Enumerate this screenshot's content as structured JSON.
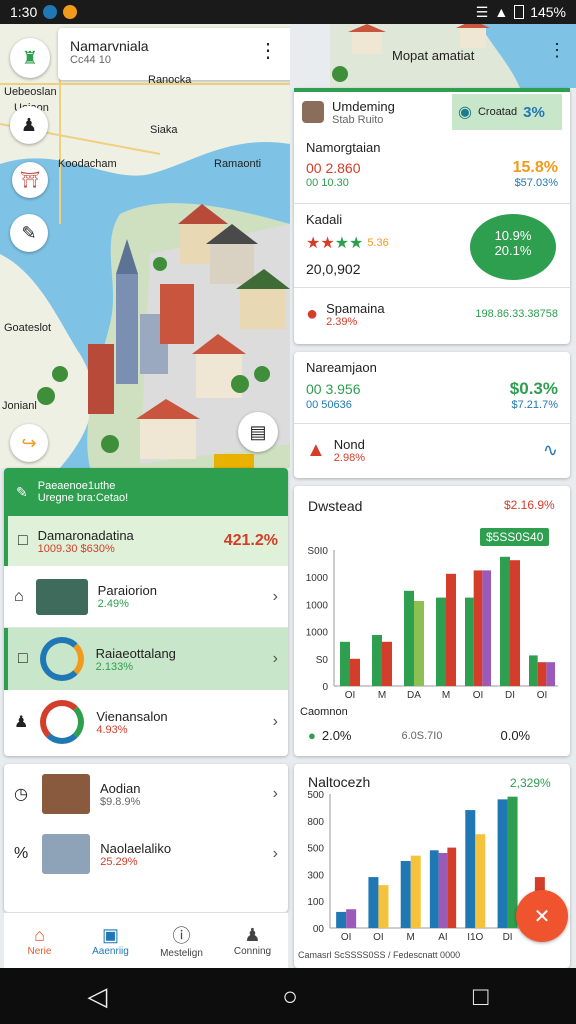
{
  "status": {
    "time": "1:30",
    "battery": "145%"
  },
  "map_header": {
    "title": "Namarvniala",
    "subtitle": "Cc44 10",
    "map_label": "Ranocka"
  },
  "map_labels": [
    "Uebeoslan",
    "Uoiaon",
    "Koodacham",
    "Ramaonti",
    "Siaka",
    "Goateslot",
    "Jonianl"
  ],
  "map2_label": "Mopat amatiat",
  "panel_header": {
    "title": "Umdeming",
    "subtitle": "Stab Ruito",
    "badge_label": "Croatad",
    "badge_value": "3%"
  },
  "stat1": {
    "title": "Namorgtaian",
    "row1_label": "00 2.860",
    "row1_value": "15.8%",
    "row2_label": "00 10.30",
    "row2_value": "$57.03%"
  },
  "stat2": {
    "title": "Kadali",
    "icons_value": "5.36",
    "big_value": "20,0,902",
    "circle_top": "10.9%",
    "circle_bottom": "20.1%"
  },
  "stat3": {
    "title": "Spamaina",
    "subtitle": "2.39%",
    "value": "198.86.33.38758"
  },
  "stat4": {
    "title": "Nareamjaon",
    "row1_label": "00 3.956",
    "row1_value": "$0.3%",
    "row2_label": "00 50636",
    "row2_value": "$7.21.7%"
  },
  "stat5": {
    "title": "Nond",
    "subtitle": "2.98%"
  },
  "chart1_card": {
    "title": "Dwstead",
    "value": "$2.16.9%",
    "badge": "$5SS0S40",
    "footer_label": "Caomnon",
    "footer_pct": "2.0%",
    "footer_mid": "6.0S.7I0",
    "footer_right": "0.0%"
  },
  "chart2_card": {
    "title": "Naltocezh",
    "value": "2,329%",
    "footer": "Camasrl  ScSSSS0SS / Fedescnatt 0000"
  },
  "list_header": {
    "title": "Paeaenoe1uthe",
    "subtitle": "Uregne bra:Cetao!"
  },
  "list_items": [
    {
      "title": "Damaronadatina",
      "sub": "1009.30  $630%",
      "value": "421.2%"
    },
    {
      "title": "Paraiorion",
      "sub": "2.49%"
    },
    {
      "title": "Raiaeottalang",
      "sub": "2.133%"
    },
    {
      "title": "Vienansalon",
      "sub": "4.93%"
    }
  ],
  "list2_items": [
    {
      "title": "Aodian",
      "sub": "$9.8.9%"
    },
    {
      "title": "Naolaelaliko",
      "sub": "25.29%"
    }
  ],
  "bottom_nav": [
    "Nerie",
    "Aaenriig",
    "Mestelign",
    "Conning"
  ],
  "chart_data": [
    {
      "type": "bar",
      "title": "Dwstead",
      "categories": [
        "OI",
        "M",
        "DA",
        "M",
        "OI",
        "DI",
        "OI"
      ],
      "y_ticks": [
        "S0I0",
        "1000",
        "1000",
        "1000",
        "S0",
        "0"
      ],
      "ylim": [
        0,
        2000
      ],
      "series": [
        {
          "color": "#2e9e4f",
          "values": [
            650,
            750,
            1400,
            1300,
            1300,
            1900,
            450
          ]
        },
        {
          "color": "#d43d2a",
          "values": [
            400,
            650,
            0,
            1650,
            1700,
            1850,
            350
          ]
        },
        {
          "color": "#9b5ab8",
          "values": [
            0,
            0,
            0,
            0,
            1700,
            0,
            350
          ]
        },
        {
          "color": "#8cc152",
          "values": [
            0,
            0,
            1250,
            0,
            0,
            0,
            0
          ]
        }
      ],
      "highlight_value": "$5SS0S40"
    },
    {
      "type": "bar",
      "title": "Naltocezh",
      "categories": [
        "OI",
        "OI",
        "M",
        "AI",
        "I1O",
        "DI",
        "OI"
      ],
      "y_ticks": [
        "500",
        "800",
        "500",
        "300",
        "100",
        "00"
      ],
      "ylim": [
        0,
        500
      ],
      "series": [
        {
          "color": "#1f78b4",
          "values": [
            60,
            190,
            250,
            290,
            440,
            480,
            0
          ]
        },
        {
          "color": "#f5c33b",
          "values": [
            0,
            160,
            270,
            0,
            350,
            0,
            0
          ]
        },
        {
          "color": "#9b5ab8",
          "values": [
            70,
            0,
            0,
            280,
            0,
            0,
            0
          ]
        },
        {
          "color": "#d43d2a",
          "values": [
            0,
            0,
            0,
            300,
            0,
            0,
            190
          ]
        },
        {
          "color": "#2e9e4f",
          "values": [
            0,
            0,
            0,
            0,
            0,
            490,
            0
          ]
        }
      ]
    }
  ]
}
